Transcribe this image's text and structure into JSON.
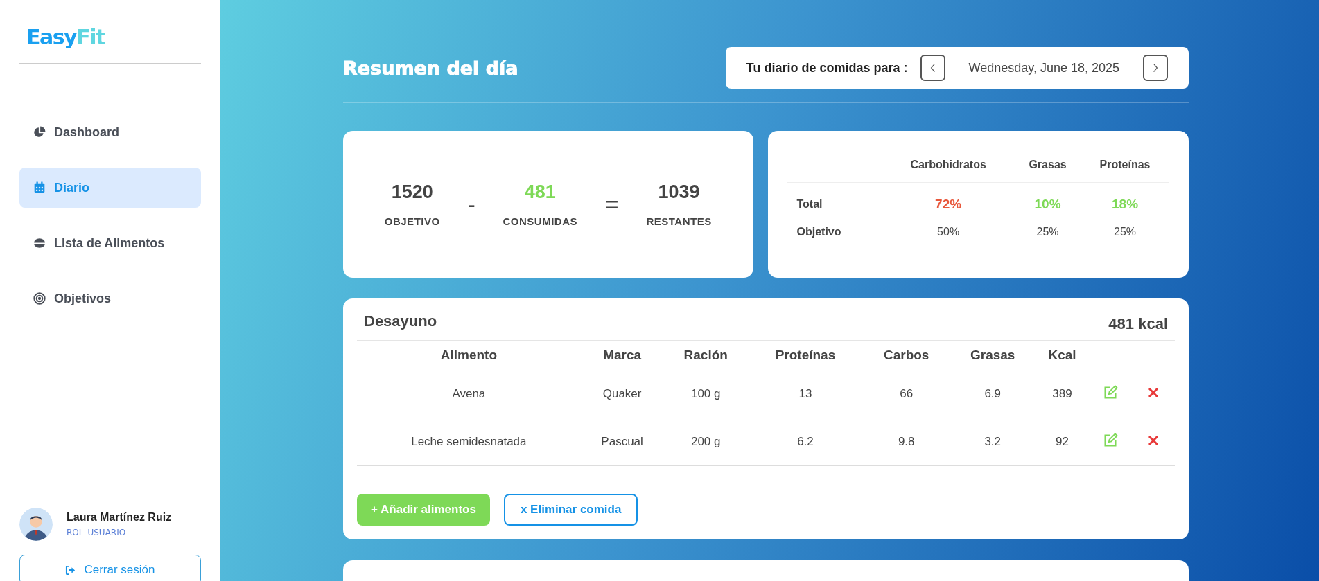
{
  "sidebar": {
    "logo": {
      "part_1": "Easy",
      "part_2": "Fit"
    },
    "items": [
      {
        "label": "Dashboard",
        "kind": "pie",
        "selected": false
      },
      {
        "label": "Diario",
        "kind": "calendar",
        "selected": true
      },
      {
        "label": "Lista de Alimentos",
        "kind": "bowl",
        "selected": false
      },
      {
        "label": "Objetivos",
        "kind": "target",
        "selected": false
      }
    ],
    "user": {
      "name": "Laura Martínez Ruiz",
      "role": "ROL_USUARIO"
    },
    "logout_button": "Cerrar sesión"
  },
  "header": {
    "title": "Resumen del día",
    "date_label": "Tu diario de comidas para :",
    "date": "Wednesday, June 18, 2025"
  },
  "calories": {
    "stats": [
      {
        "value": "1520",
        "label": "OBJETIVO",
        "color": "#444444"
      },
      {
        "value": "481",
        "label": "CONSUMIDAS",
        "color": "#7ed957"
      },
      {
        "value": "1039",
        "label": "RESTANTES",
        "color": "#444444"
      }
    ],
    "operators": [
      "-",
      "="
    ]
  },
  "macros": {
    "columns": [
      "Carbohidratos",
      "Grasas",
      "Proteínas"
    ],
    "rows": [
      {
        "label": "Total",
        "cells": [
          {
            "text": "72%",
            "color": "#e8583c"
          },
          {
            "text": "10%",
            "color": "#7ed957"
          },
          {
            "text": "18%",
            "color": "#7ed957"
          }
        ]
      },
      {
        "label": "Objetivo",
        "cells": [
          {
            "text": "50%"
          },
          {
            "text": "25%"
          },
          {
            "text": "25%"
          }
        ]
      }
    ]
  },
  "meals": [
    {
      "kind": "full",
      "title": "Desayuno",
      "total": "481 kcal",
      "columns": [
        "Alimento",
        "Marca",
        "Ración",
        "Proteínas",
        "Carbos",
        "Grasas",
        "Kcal"
      ],
      "rows": [
        [
          "Avena",
          "Quaker",
          "100 g",
          "13",
          "66",
          "6.9",
          "389"
        ],
        [
          "Leche semidesnatada",
          "Pascual",
          "200 g",
          "6.2",
          "9.8",
          "3.2",
          "92"
        ]
      ],
      "add_button": "+ Añadir alimentos",
      "delete_button": "x Eliminar comida"
    },
    {
      "kind": "cut"
    }
  ]
}
